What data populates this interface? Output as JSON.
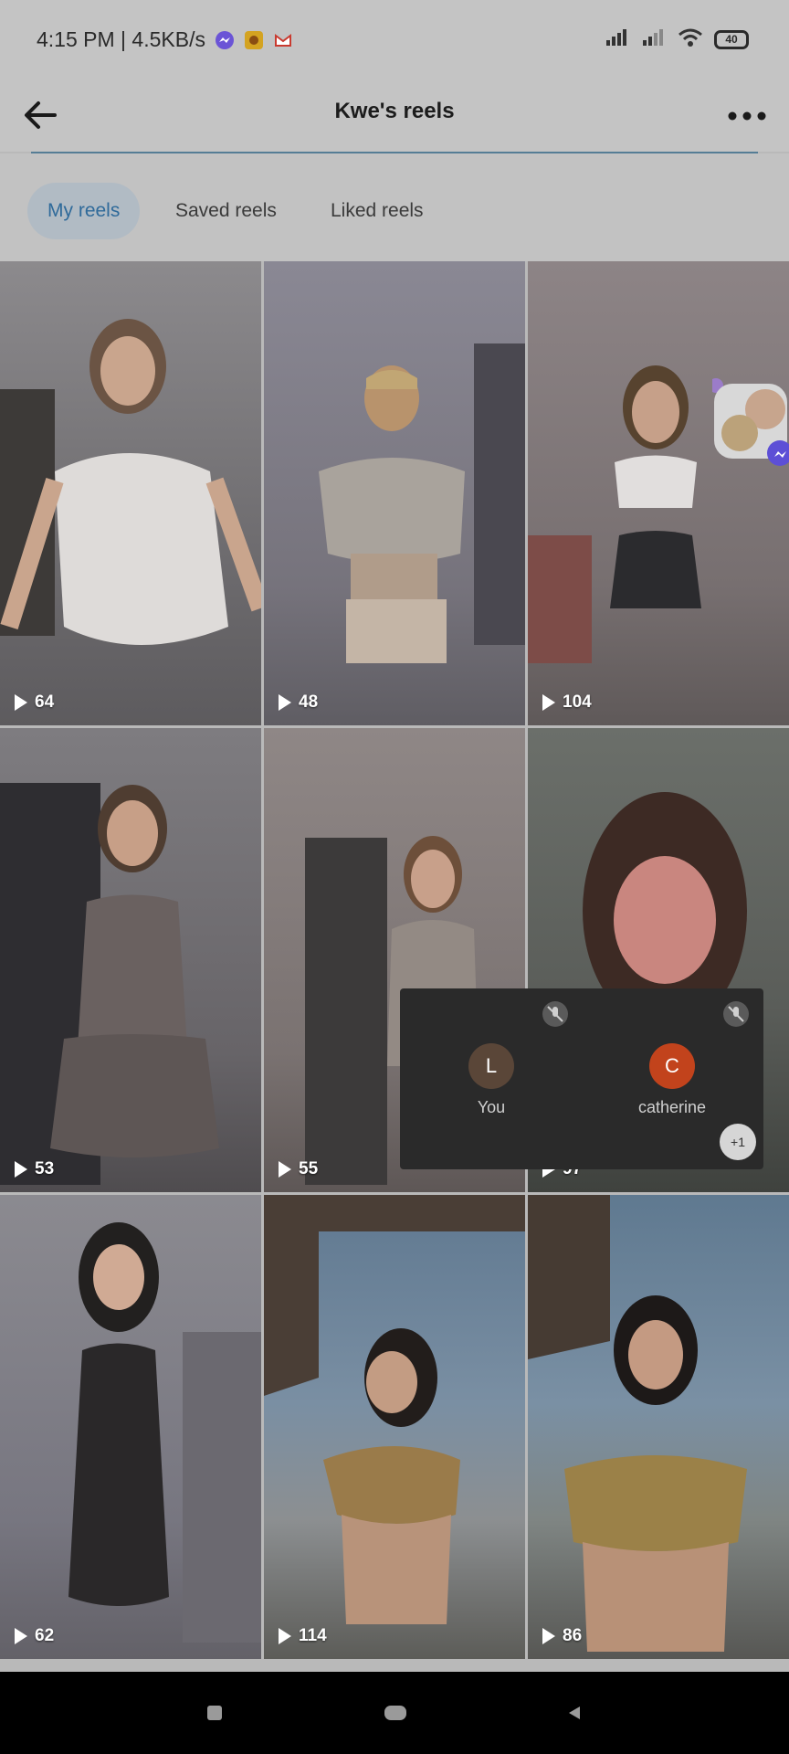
{
  "status": {
    "time_net": "4:15 PM | 4.5KB/s",
    "battery": "40"
  },
  "header": {
    "title": "Kwe's reels"
  },
  "tabs": [
    {
      "label": "My reels",
      "active": true
    },
    {
      "label": "Saved reels",
      "active": false
    },
    {
      "label": "Liked reels",
      "active": false
    }
  ],
  "reels": [
    {
      "count": "64"
    },
    {
      "count": "48"
    },
    {
      "count": "104"
    },
    {
      "count": "53"
    },
    {
      "count": "55"
    },
    {
      "count": "97"
    },
    {
      "count": "62"
    },
    {
      "count": "114"
    },
    {
      "count": "86"
    }
  ],
  "call": {
    "participants": [
      {
        "initial": "L",
        "name": "You",
        "color": "#5a4638"
      },
      {
        "initial": "C",
        "name": "catherine",
        "color": "#c2431c"
      }
    ],
    "extra": "+1"
  }
}
